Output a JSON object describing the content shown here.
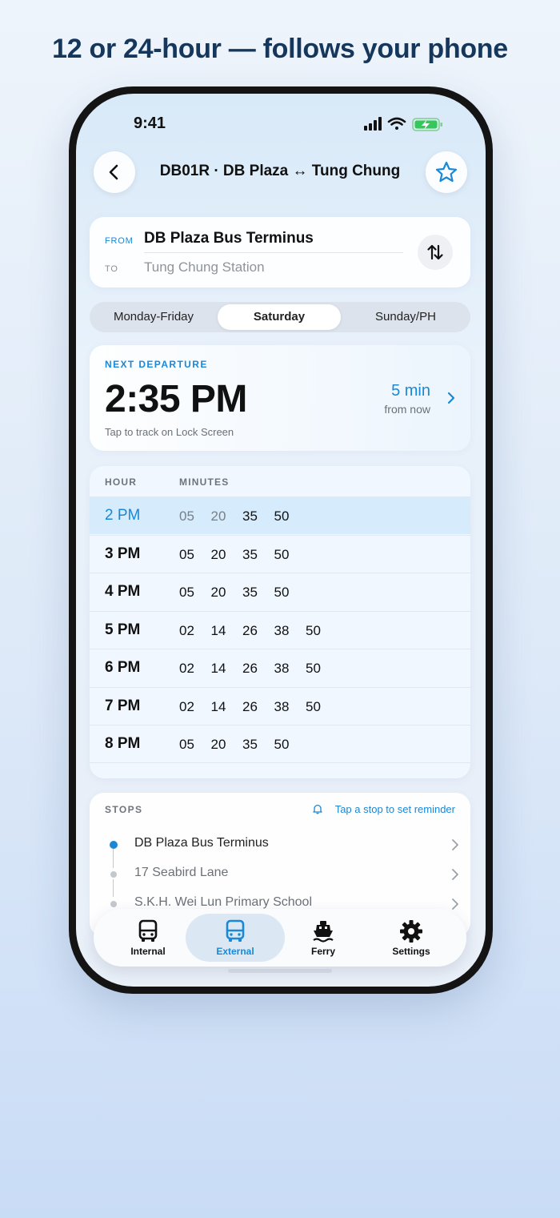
{
  "headline": "12 or 24-hour — follows your phone",
  "status_bar": {
    "time": "9:41"
  },
  "nav": {
    "title": "DB01R · DB Plaza ↔ Tung Chung"
  },
  "route": {
    "from_label": "FROM",
    "from_value": "DB Plaza Bus Terminus",
    "to_label": "TO",
    "to_value": "Tung Chung Station"
  },
  "day_tabs": [
    {
      "label": "Monday-Friday",
      "selected": false
    },
    {
      "label": "Saturday",
      "selected": true
    },
    {
      "label": "Sunday/PH",
      "selected": false
    }
  ],
  "next_departure": {
    "label": "NEXT DEPARTURE",
    "time": "2:35 PM",
    "hint": "Tap to track on Lock Screen",
    "eta": "5 min",
    "eta_suffix": "from now"
  },
  "timetable": {
    "hour_header": "HOUR",
    "minutes_header": "MINUTES",
    "rows": [
      {
        "hour": "2 PM",
        "minutes": [
          "05",
          "20",
          "35",
          "50"
        ]
      },
      {
        "hour": "3 PM",
        "minutes": [
          "05",
          "20",
          "35",
          "50"
        ]
      },
      {
        "hour": "4 PM",
        "minutes": [
          "05",
          "20",
          "35",
          "50"
        ]
      },
      {
        "hour": "5 PM",
        "minutes": [
          "02",
          "14",
          "26",
          "38",
          "50"
        ]
      },
      {
        "hour": "6 PM",
        "minutes": [
          "02",
          "14",
          "26",
          "38",
          "50"
        ]
      },
      {
        "hour": "7 PM",
        "minutes": [
          "02",
          "14",
          "26",
          "38",
          "50"
        ]
      },
      {
        "hour": "8 PM",
        "minutes": [
          "05",
          "20",
          "35",
          "50"
        ]
      }
    ]
  },
  "stops": {
    "title": "STOPS",
    "hint": "Tap a stop to set reminder",
    "items": [
      "DB Plaza Bus Terminus",
      "17 Seabird Lane",
      "S.K.H. Wei Lun Primary School"
    ]
  },
  "tab_bar": {
    "tabs": [
      {
        "label": "Internal",
        "icon": "bus-icon"
      },
      {
        "label": "External",
        "icon": "bus-icon"
      },
      {
        "label": "Ferry",
        "icon": "ferry-icon"
      },
      {
        "label": "Settings",
        "icon": "gear-icon"
      }
    ]
  },
  "colors": {
    "accent": "#1a88d6",
    "headline": "#16375c"
  }
}
